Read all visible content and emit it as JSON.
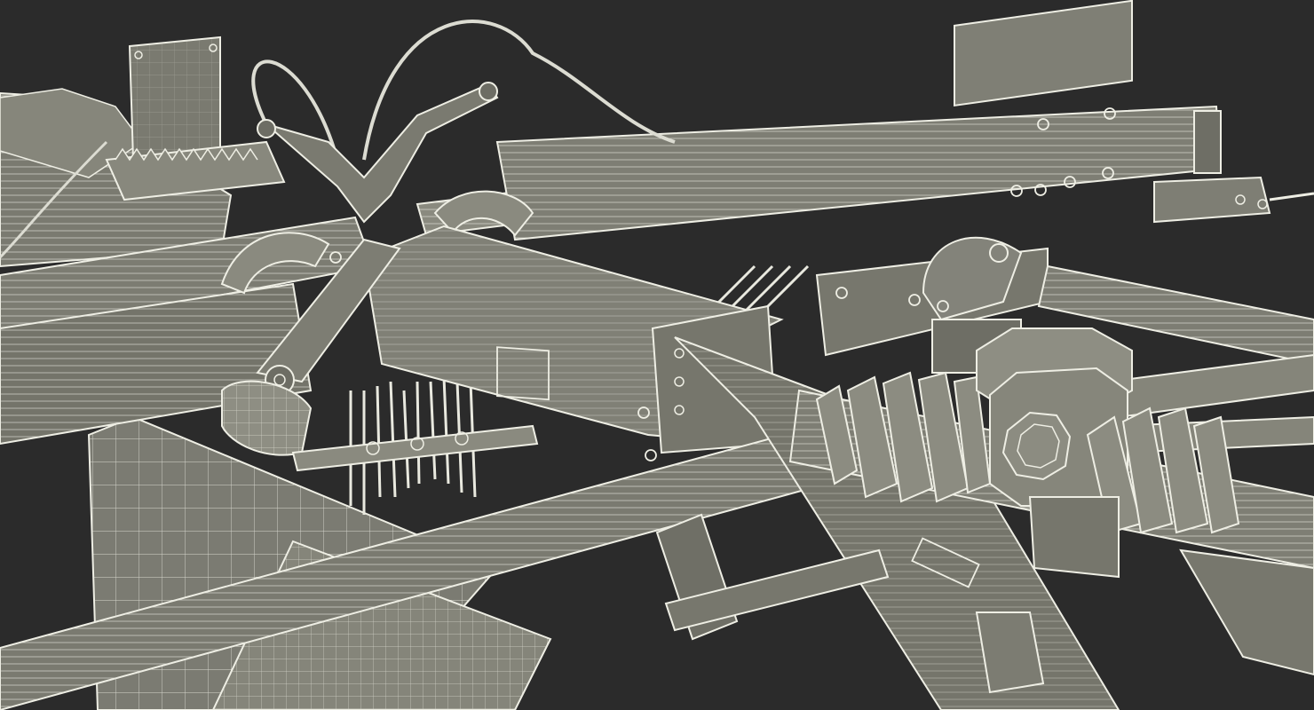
{
  "scene": {
    "background_color": "#2b2b2b",
    "surface_color": "#7a7a70",
    "surface_light_color": "#9a9a8e",
    "surface_dark_color": "#55554d",
    "wire_color": "#e9e9df",
    "rendering": "wireframe"
  }
}
